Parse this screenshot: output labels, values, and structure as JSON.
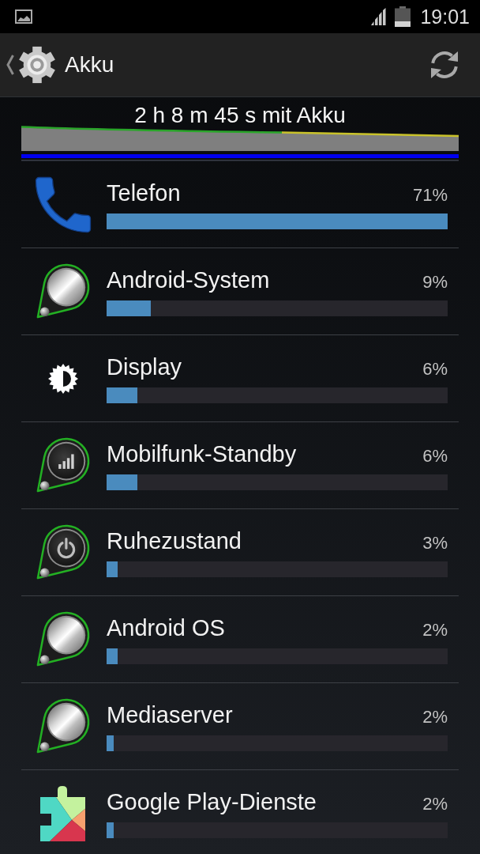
{
  "status_bar": {
    "time": "19:01"
  },
  "action_bar": {
    "title": "Akku"
  },
  "battery_graph": {
    "caption": "2 h 8 m 45 s mit Akku"
  },
  "items": [
    {
      "kind": "phone",
      "name": "Telefon",
      "percent": "71%",
      "level": 1
    },
    {
      "kind": "system",
      "name": "Android-System",
      "percent": "9%",
      "level": 0.13
    },
    {
      "kind": "display",
      "name": "Display",
      "percent": "6%",
      "level": 0.09
    },
    {
      "kind": "signal",
      "name": "Mobilfunk-Standby",
      "percent": "6%",
      "level": 0.09
    },
    {
      "kind": "power",
      "name": "Ruhezustand",
      "percent": "3%",
      "level": 0.032
    },
    {
      "kind": "system",
      "name": "Android OS",
      "percent": "2%",
      "level": 0.032
    },
    {
      "kind": "system",
      "name": "Mediaserver",
      "percent": "2%",
      "level": 0.021
    },
    {
      "kind": "puzzle",
      "name": "Google Play-Dienste",
      "percent": "2%",
      "level": 0.021
    }
  ]
}
